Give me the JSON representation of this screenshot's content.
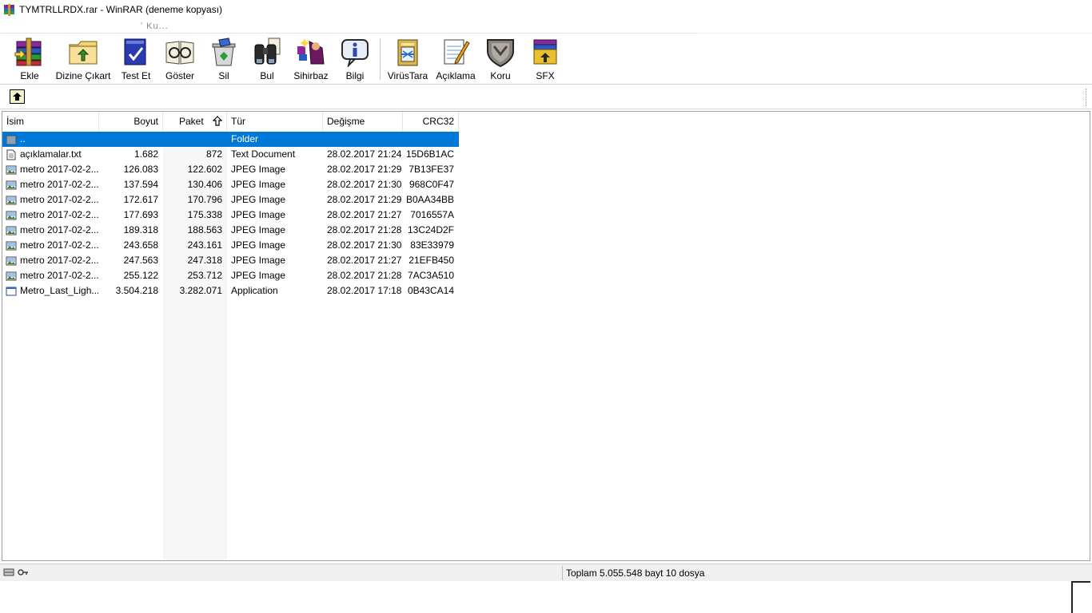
{
  "window": {
    "title": "TYMTRLLRDX.rar - WinRAR (deneme kopyası)"
  },
  "menu": {
    "fragment": "ʹ Ku..."
  },
  "toolbar": {
    "buttons": [
      {
        "id": "add",
        "label": "Ekle",
        "icon": "books-archive-icon"
      },
      {
        "id": "extract",
        "label": "Dizine Çıkart",
        "icon": "folder-extract-icon"
      },
      {
        "id": "test",
        "label": "Test Et",
        "icon": "test-book-icon"
      },
      {
        "id": "view",
        "label": "Göster",
        "icon": "glasses-book-icon"
      },
      {
        "id": "delete",
        "label": "Sil",
        "icon": "recycle-bin-icon"
      },
      {
        "id": "find",
        "label": "Bul",
        "icon": "binoculars-icon"
      },
      {
        "id": "wizard",
        "label": "Sihirbaz",
        "icon": "wizard-icon"
      },
      {
        "id": "info",
        "label": "Bilgi",
        "icon": "info-icon"
      },
      {
        "id": "virusscan",
        "label": "VirüsTara",
        "icon": "virus-scan-icon"
      },
      {
        "id": "comment",
        "label": "Açıklama",
        "icon": "comment-pen-icon"
      },
      {
        "id": "protect",
        "label": "Koru",
        "icon": "shield-icon"
      },
      {
        "id": "sfx",
        "label": "SFX",
        "icon": "sfx-box-icon"
      }
    ]
  },
  "columns": {
    "name": "İsim",
    "size": "Boyut",
    "packed": "Paket",
    "type": "Tür",
    "modified": "Değişme",
    "crc": "CRC32"
  },
  "files": [
    {
      "name": "..",
      "size": "",
      "packed": "",
      "type": "Folder",
      "modified": "",
      "crc": "",
      "icon": "folder-up-icon",
      "selected": true
    },
    {
      "name": "açıklamalar.txt",
      "size": "1.682",
      "packed": "872",
      "type": "Text Document",
      "modified": "28.02.2017 21:24",
      "crc": "15D6B1AC",
      "icon": "text-file-icon"
    },
    {
      "name": "metro 2017-02-2...",
      "size": "126.083",
      "packed": "122.602",
      "type": "JPEG Image",
      "modified": "28.02.2017 21:29",
      "crc": "7B13FE37",
      "icon": "image-file-icon"
    },
    {
      "name": "metro 2017-02-2...",
      "size": "137.594",
      "packed": "130.406",
      "type": "JPEG Image",
      "modified": "28.02.2017 21:30",
      "crc": "968C0F47",
      "icon": "image-file-icon"
    },
    {
      "name": "metro 2017-02-2...",
      "size": "172.617",
      "packed": "170.796",
      "type": "JPEG Image",
      "modified": "28.02.2017 21:29",
      "crc": "B0AA34BB",
      "icon": "image-file-icon"
    },
    {
      "name": "metro 2017-02-2...",
      "size": "177.693",
      "packed": "175.338",
      "type": "JPEG Image",
      "modified": "28.02.2017 21:27",
      "crc": "7016557A",
      "icon": "image-file-icon"
    },
    {
      "name": "metro 2017-02-2...",
      "size": "189.318",
      "packed": "188.563",
      "type": "JPEG Image",
      "modified": "28.02.2017 21:28",
      "crc": "13C24D2F",
      "icon": "image-file-icon"
    },
    {
      "name": "metro 2017-02-2...",
      "size": "243.658",
      "packed": "243.161",
      "type": "JPEG Image",
      "modified": "28.02.2017 21:30",
      "crc": "83E33979",
      "icon": "image-file-icon"
    },
    {
      "name": "metro 2017-02-2...",
      "size": "247.563",
      "packed": "247.318",
      "type": "JPEG Image",
      "modified": "28.02.2017 21:27",
      "crc": "21EFB450",
      "icon": "image-file-icon"
    },
    {
      "name": "metro 2017-02-2...",
      "size": "255.122",
      "packed": "253.712",
      "type": "JPEG Image",
      "modified": "28.02.2017 21:28",
      "crc": "7AC3A510",
      "icon": "image-file-icon"
    },
    {
      "name": "Metro_Last_Ligh...",
      "size": "3.504.218",
      "packed": "3.282.071",
      "type": "Application",
      "modified": "28.02.2017 17:18",
      "crc": "0B43CA14",
      "icon": "application-icon"
    }
  ],
  "status": {
    "total": "Toplam 5.055.548 bayt 10 dosya"
  },
  "colors": {
    "selection": "#0078d7",
    "sorted_column": "#f7f7f7"
  }
}
